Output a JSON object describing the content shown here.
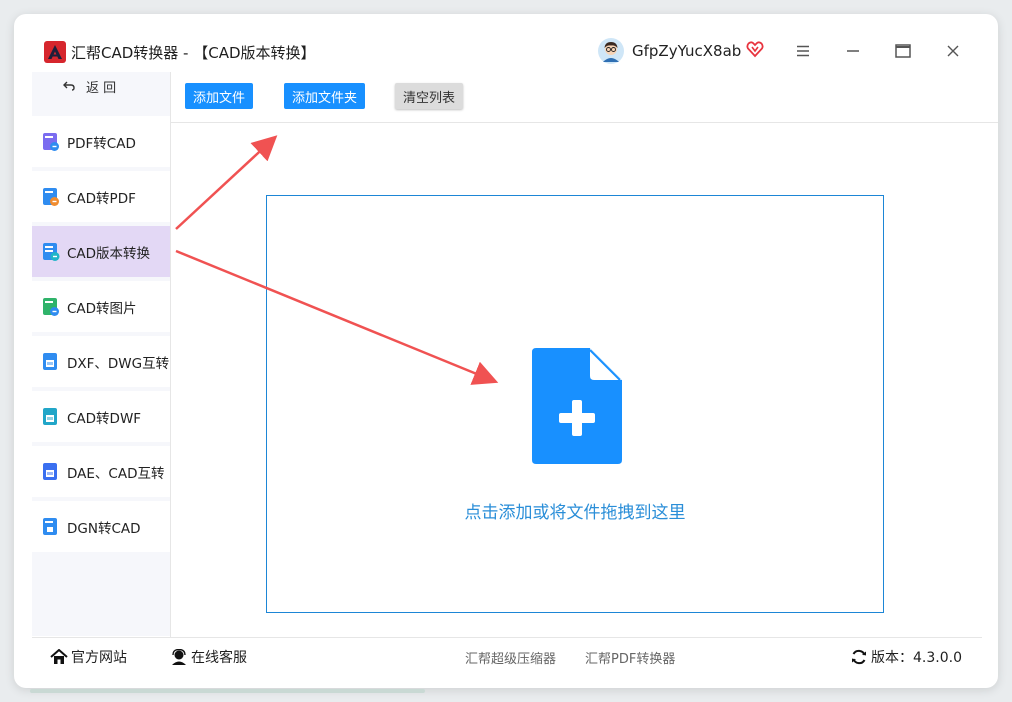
{
  "window": {
    "title": "汇帮CAD转换器 - 【CAD版本转换】",
    "username": "GfpZyYucX8ab"
  },
  "icons": {
    "logo": "app-logo-icon",
    "avatar": "avatar-icon",
    "vip": "vip-heart-icon",
    "menu": "menu-icon",
    "minimize": "minimize-icon",
    "maximize": "maximize-icon",
    "close": "close-icon",
    "back": "back-arrow-icon",
    "file_plus": "file-plus-icon",
    "home": "home-icon",
    "support": "support-icon",
    "refresh": "refresh-icon"
  },
  "colors": {
    "accent": "#1890ff",
    "active_nav": "#e3d8f5",
    "drop_border": "#1d86d6",
    "annotation_arrow": "#f05252"
  },
  "sidebar": {
    "back_label": "返 回",
    "items": [
      {
        "label": "PDF转CAD",
        "active": false
      },
      {
        "label": "CAD转PDF",
        "active": false
      },
      {
        "label": "CAD版本转换",
        "active": true
      },
      {
        "label": "CAD转图片",
        "active": false
      },
      {
        "label": "DXF、DWG互转",
        "active": false
      },
      {
        "label": "CAD转DWF",
        "active": false
      },
      {
        "label": "DAE、CAD互转",
        "active": false
      },
      {
        "label": "DGN转CAD",
        "active": false
      }
    ]
  },
  "toolbar": {
    "add_file": "添加文件",
    "add_folder": "添加文件夹",
    "clear_list": "清空列表"
  },
  "dropzone": {
    "hint": "点击添加或将文件拖拽到这里"
  },
  "footer": {
    "website": "官方网站",
    "support": "在线客服",
    "compressor": "汇帮超级压缩器",
    "pdf_converter": "汇帮PDF转换器",
    "version": "版本：4.3.0.0"
  }
}
